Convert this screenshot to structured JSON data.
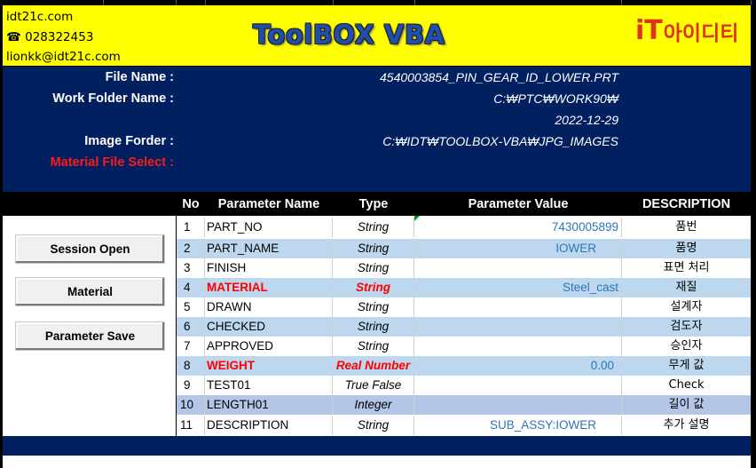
{
  "header": {
    "contact": [
      "idt21c.com",
      "☎ 028322453",
      "lionkk@idt21c.com"
    ],
    "title": "ToolBOX VBA",
    "logo_mark": "iT",
    "logo_text": "아이디티"
  },
  "info": {
    "file_name_label": "File Name :",
    "file_name_value": "4540003854_PIN_GEAR_ID_LOWER.PRT",
    "work_folder_label": "Work Folder Name :",
    "work_folder_value": "C:₩PTC₩WORK90₩",
    "date_value": "2022-12-29",
    "image_folder_label": "Image Forder :",
    "image_folder_value": "C:₩IDT₩TOOLBOX-VBA₩JPG_IMAGES",
    "material_file_label": "Material File Select :"
  },
  "buttons": {
    "session_open": "Session Open",
    "material": "Material",
    "parameter_save": "Parameter Save"
  },
  "table": {
    "headers": [
      "No",
      "Parameter Name",
      "Type",
      "Parameter Value",
      "DESCRIPTION"
    ],
    "rows": [
      {
        "no": "1",
        "name": "PART_NO",
        "type": "String",
        "value": "7430005899",
        "desc": "품번"
      },
      {
        "no": "2",
        "name": "PART_NAME",
        "type": "String",
        "value": "IOWER",
        "desc": "품명"
      },
      {
        "no": "3",
        "name": "FINISH",
        "type": "String",
        "value": "",
        "desc": "표면 처리"
      },
      {
        "no": "4",
        "name": "MATERIAL",
        "type": "String",
        "value": "Steel_cast",
        "desc": "재질"
      },
      {
        "no": "5",
        "name": "DRAWN",
        "type": "String",
        "value": "",
        "desc": "설계자"
      },
      {
        "no": "6",
        "name": "CHECKED",
        "type": "String",
        "value": "",
        "desc": "검도자"
      },
      {
        "no": "7",
        "name": "APPROVED",
        "type": "String",
        "value": "",
        "desc": "승인자"
      },
      {
        "no": "8",
        "name": "WEIGHT",
        "type": "Real Number",
        "value": "0.00",
        "desc": "무게 값"
      },
      {
        "no": "9",
        "name": "TEST01",
        "type": "True False",
        "value": "",
        "desc": "Check"
      },
      {
        "no": "10",
        "name": "LENGTH01",
        "type": "Integer",
        "value": "",
        "desc": "길이 값"
      },
      {
        "no": "11",
        "name": "DESCRIPTION",
        "type": "String",
        "value": "SUB_ASSY:IOWER",
        "desc": "추가 설명"
      }
    ]
  },
  "colors": {
    "header_bg": "#ffff00",
    "panel_bg": "#002060",
    "row_alt": "#bdd7ee",
    "value_text": "#2e75b6",
    "highlight": "#ff0000"
  }
}
